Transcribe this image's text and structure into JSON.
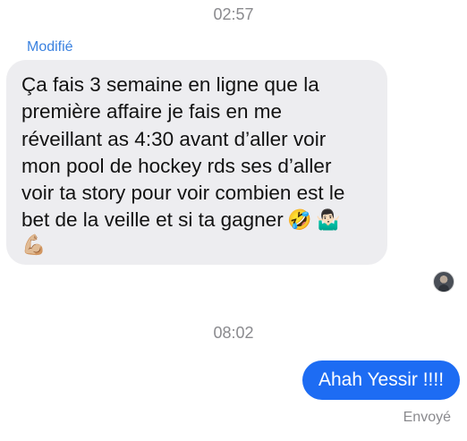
{
  "timestamps": {
    "first": "02:57",
    "second": "08:02"
  },
  "incoming_message": {
    "edited_label": "Modifié",
    "text": "Ça fais 3 semaine en ligne que la\npremière affaire je fais en me\nréveillant  as 4:30 avant d’aller voir\nmon pool de hockey rds ses d’aller\nvoir ta story pour voir combien est le\nbet de la veille et si ta gagner",
    "emojis": [
      "🤣",
      "🤷🏻‍♂️",
      "💪🏼"
    ]
  },
  "outgoing_message": {
    "text": "Ahah Yessir !!!!",
    "status": "Envoyé"
  },
  "icons": {
    "avatar": "avatar"
  },
  "colors": {
    "background": "#ffffff",
    "incoming_bubble": "#ededf0",
    "outgoing_bubble": "#1d6cf3",
    "edited_label": "#3b82e0",
    "meta_text": "#8a8a8e"
  }
}
